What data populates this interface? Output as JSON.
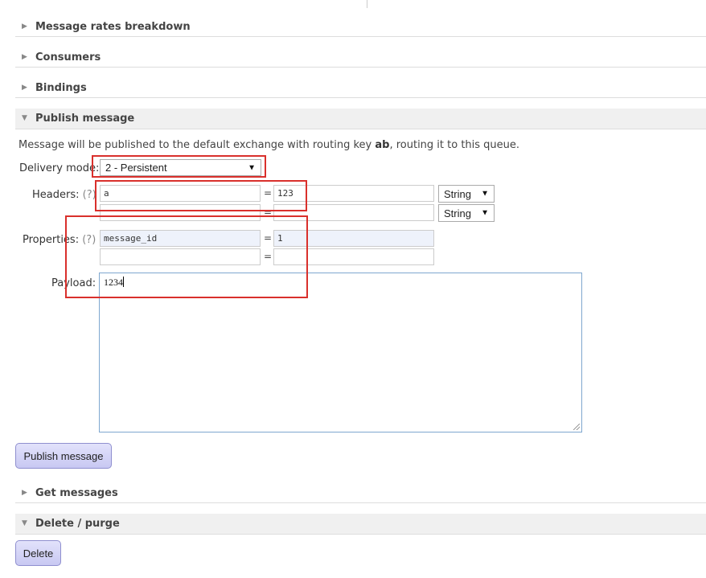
{
  "sections": {
    "message_rates": {
      "label": "Message rates breakdown",
      "expanded": false
    },
    "consumers": {
      "label": "Consumers",
      "expanded": false
    },
    "bindings": {
      "label": "Bindings",
      "expanded": false
    },
    "publish": {
      "label": "Publish message",
      "expanded": true
    },
    "get_messages": {
      "label": "Get messages",
      "expanded": false
    },
    "delete_purge": {
      "label": "Delete / purge",
      "expanded": true
    }
  },
  "icons": {
    "collapsed": "triangle-right-icon",
    "expanded": "triangle-down-icon",
    "collapsed_glyph": "▶",
    "expanded_glyph": "▼",
    "select_glyph": "▼"
  },
  "publish_form": {
    "intro_before": "Message will be published to the default exchange with routing key ",
    "routing_key": "ab",
    "intro_after": ", routing it to this queue.",
    "delivery_mode_label": "Delivery mode:",
    "delivery_mode_value": "2 - Persistent",
    "headers_label": "Headers:",
    "properties_label": "Properties:",
    "help_text": "(?)",
    "equals": "=",
    "headers": [
      {
        "key": "a",
        "value": "123",
        "type": "String"
      },
      {
        "key": "",
        "value": "",
        "type": "String"
      }
    ],
    "properties": [
      {
        "key": "message_id",
        "value": "1"
      },
      {
        "key": "",
        "value": ""
      }
    ],
    "payload_label": "Payload:",
    "payload_value": "1234",
    "publish_button": "Publish message"
  },
  "delete_form": {
    "delete_button": "Delete"
  },
  "colors": {
    "annotation_red": "#d9302c",
    "button_fill": "#c8c8f2",
    "input_filled": "#eef2fb"
  }
}
